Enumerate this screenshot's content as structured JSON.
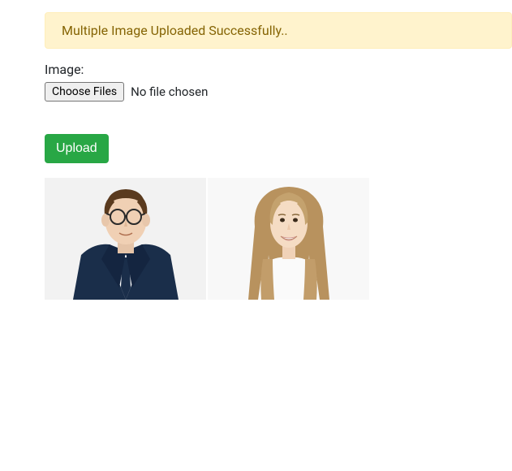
{
  "alert": {
    "message": "Multiple Image Uploaded Successfully.."
  },
  "form": {
    "label": "Image:",
    "choose_button": "Choose Files",
    "file_status": "No file chosen",
    "upload_button": "Upload"
  },
  "images": {
    "count": 2
  }
}
